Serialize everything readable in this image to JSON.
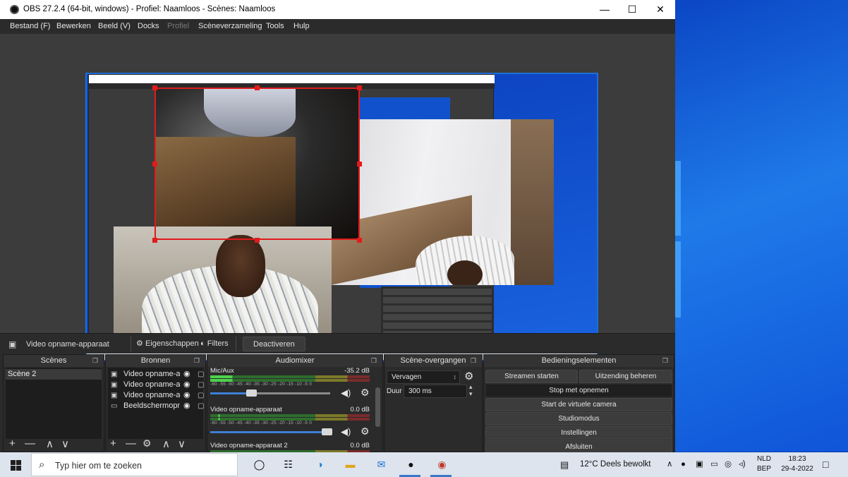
{
  "window": {
    "title": "OBS 27.2.4 (64-bit, windows) - Profiel: Naamloos - Scènes: Naamloos",
    "controls": {
      "minimize": "—",
      "maximize": "☐",
      "close": "✕"
    }
  },
  "menu": [
    {
      "label": "Bestand (F)",
      "enabled": true
    },
    {
      "label": "Bewerken",
      "enabled": true
    },
    {
      "label": "Beeld (V)",
      "enabled": true
    },
    {
      "label": "Docks",
      "enabled": true
    },
    {
      "label": "Profiel",
      "enabled": false
    },
    {
      "label": "Scèneverzameling",
      "enabled": true
    },
    {
      "label": "Tools",
      "enabled": true
    },
    {
      "label": "Hulp",
      "enabled": true
    }
  ],
  "source_toolbar": {
    "selected_source": "Video opname-apparaat",
    "properties_label": "Eigenschappen",
    "filters_label": "Filters",
    "deactivate_label": "Deactiveren"
  },
  "scenes_dock": {
    "title": "Scènes",
    "items": [
      "Scène 2"
    ],
    "footer": [
      "+",
      "—",
      "∧",
      "∨"
    ]
  },
  "sources_dock": {
    "title": "Bronnen",
    "items": [
      {
        "name": "Video opname-apparaat",
        "icon": "camera-icon"
      },
      {
        "name": "Video opname-apparaat",
        "icon": "camera-icon"
      },
      {
        "name": "Video opname-apparaat",
        "icon": "camera-icon"
      },
      {
        "name": "Beeldschermopname",
        "icon": "monitor-icon"
      }
    ],
    "footer": [
      "+",
      "—",
      "⚙",
      "∧",
      "∨"
    ]
  },
  "audio_mixer": {
    "title": "Audiomixer",
    "scale": "-60  -55  -50  -45  -40  -35  -30  -25  -20  -15  -10  -5   0",
    "channels": [
      {
        "name": "Mic/Aux",
        "db": "-35.2 dB",
        "volume_fraction": 0.34
      },
      {
        "name": "Video opname-apparaat",
        "db": "0.0 dB",
        "volume_fraction": 0.97
      },
      {
        "name": "Video opname-apparaat 2",
        "db": "0.0 dB",
        "volume_fraction": 0.97
      }
    ]
  },
  "transitions_dock": {
    "title": "Scène-overgangen",
    "transition": "Vervagen",
    "duration_label": "Duur",
    "duration_value": "300 ms"
  },
  "controls_dock": {
    "title": "Bedieningselementen",
    "buttons": {
      "start_stream": "Streamen starten",
      "manage_broadcast": "Uitzending beheren",
      "stop_recording": "Stop met opnemen",
      "virtual_camera": "Start de virtuele camera",
      "studio_mode": "Studiomodus",
      "settings": "Instellingen",
      "exit": "Afsluiten"
    }
  },
  "taskbar": {
    "search_placeholder": "Typ hier om te zoeken",
    "weather": "12°C  Deels bewolkt",
    "language_top": "NLD",
    "language_bottom": "BEP",
    "time": "18:23",
    "date": "29-4-2022"
  },
  "colors": {
    "obs_bg": "#2b2b2b",
    "selection_red": "#e01b1b",
    "canvas_border": "#1e6fd6",
    "desktop_blue": "#0b46c4"
  }
}
